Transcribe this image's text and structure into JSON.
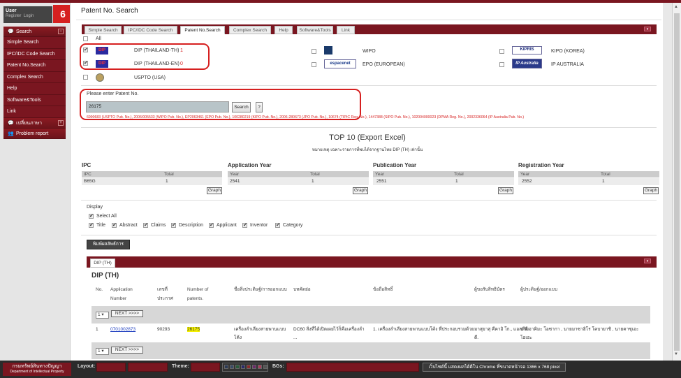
{
  "user": {
    "name": "User",
    "register": "Register",
    "login": "Login"
  },
  "badge": "6",
  "sidebar": {
    "search_header": "Search",
    "items": [
      {
        "label": "Simple Search"
      },
      {
        "label": "IPC/IDC Code Search"
      },
      {
        "label": "Patent No.Search"
      },
      {
        "label": "Complex Search"
      },
      {
        "label": "Help"
      },
      {
        "label": "Software&Tools"
      },
      {
        "label": "Link"
      }
    ],
    "language_header": "เปลี่ยนภาษา",
    "problem_header": "Problem report"
  },
  "page": {
    "title": "Patent No. Search"
  },
  "tabs": [
    {
      "label": "Simple Search"
    },
    {
      "label": "IPC/IDC Code Search"
    },
    {
      "label": "Patent No.Search"
    },
    {
      "label": "Complex Search"
    },
    {
      "label": "Help"
    },
    {
      "label": "Software&Tools"
    },
    {
      "label": "Link"
    }
  ],
  "tab_toggle": "▾",
  "databases": {
    "all_label": "All",
    "dip_th": {
      "logo": "DIP",
      "label": "DIP (THAILAND-TH)",
      "count": "1"
    },
    "dip_en": {
      "logo": "DIP",
      "label": "DIP (THAILAND-EN)",
      "count": "0"
    },
    "uspto": {
      "label": "USPTO (USA)"
    },
    "wipo": {
      "label": "WIPO"
    },
    "epo": {
      "logo": "espacenet",
      "label": "EPO (EUROPEAN)"
    },
    "kipo": {
      "logo": "KIPRIS",
      "label": "KIPO (KOREA)"
    },
    "ipau": {
      "logo": "IP Australia",
      "label": "IP AUSTRALIA"
    }
  },
  "search": {
    "prompt": "Please enter Patent No.",
    "value": "26175",
    "button": "Search",
    "help": "?",
    "results_line": "6990683 (USPTO Pub. No.), 2006/005533 (WIPO Pub. No.), EP2063461 (EPO Pub. No.), 100280219 (KIPO Pub. No.), 2006-280673 (JPO Pub. No.), 10674 (TIPIC Reg. No.), 1447388 (SIPO Pub. No.), 102004000023 (DPMA Reg. No.), 2002336064 (IP Australia Pub. No.)"
  },
  "top10": {
    "title": "TOP 10 (Export Excel)",
    "note": "หมายเหตุ เฉพาะรายการที่พบได้จากฐานไทย DIP (TH) เท่านั้น",
    "sections": [
      {
        "title": "IPC",
        "col1": "IPC",
        "col2": "Total",
        "val1": "B65G",
        "val2": "1",
        "graph": "Graph"
      },
      {
        "title": "Application Year",
        "col1": "Year",
        "col2": "Total",
        "val1": "2541",
        "val2": "1",
        "graph": "Graph"
      },
      {
        "title": "Publication Year",
        "col1": "Year",
        "col2": "Total",
        "val1": "2551",
        "val2": "1",
        "graph": "Graph"
      },
      {
        "title": "Registration Year",
        "col1": "Year",
        "col2": "Total",
        "val1": "2552",
        "val2": "1",
        "graph": "Graph"
      }
    ]
  },
  "display": {
    "label": "Display",
    "select_all": "Select All",
    "options": [
      "Title",
      "Abstract",
      "Claims",
      "Description",
      "Applicant",
      "Inventor",
      "Category"
    ]
  },
  "print_button": "พิมพ์ผลลัพธ์การค้นหา",
  "results": {
    "tab": "DIP (TH)",
    "toggle": "▾",
    "heading": "DIP (TH)",
    "columns": {
      "no": "No.",
      "app_line1": "Application",
      "app_line2": "Number",
      "pub_line1": "เลขที่",
      "pub_line2": "ประกาศ",
      "num_line1": "Number of",
      "num_line2": "patents.",
      "title": "ชื่อสิ่งประดิษฐ์/การออกแบบ",
      "abstract": "บทคัดย่อ",
      "claims": "ข้อถือสิทธิ์",
      "applicant": "ผู้ขอรับสิทธิบัตร",
      "inventor": "ผู้ประดิษฐ์/ออกแบบ"
    },
    "pager": {
      "page": "1",
      "next": "NEXT >>>>"
    },
    "rows": [
      {
        "no": "1",
        "app": "0701002873",
        "pub": "90293",
        "num": "26175",
        "title_l1": "เครื่องลำเลียงสายพานแบบ",
        "title_l2": "โค้ง",
        "abstract_l1": "DC60 สิ่งที่ได้เปิดเผยไว้ก็คือเครื่องลำ",
        "abstract_l2": "...",
        "claims": "1. เครื่องลำเลียงสายพานแบบโค้ง ที่ประกอบรวมด้วย",
        "applicant_l1": "มาสุยาสุ คีคาอิ โก., แอลทีดี",
        "applicant_l2": "ดี.",
        "inventor_l1": "นายอาคิมะ โอซากา , นายมาซาฮิโร โคบายาชิ , นายคาซุเอะ",
        "inventor_l2": "โอเอะ"
      }
    ]
  },
  "bottom": {
    "brand_l1": "กรมทรัพย์สินทางปัญญา",
    "brand_l2": "Department of Intellectual Property",
    "layout": "Layout:",
    "theme": "Theme:",
    "bgs": "BGs:",
    "message": "เว็บไซต์นี้ แสดงผลได้ดีใน Chrome ที่ขนาดหน้าจอ 1366 x 768 pixel",
    "theme_colors": [
      "#2b3a55",
      "#3a4a66",
      "#2a5a3a",
      "#2a2a6a",
      "#8a2a2a",
      "#6a2a6a",
      "#aa3a5a",
      "#555555"
    ]
  }
}
